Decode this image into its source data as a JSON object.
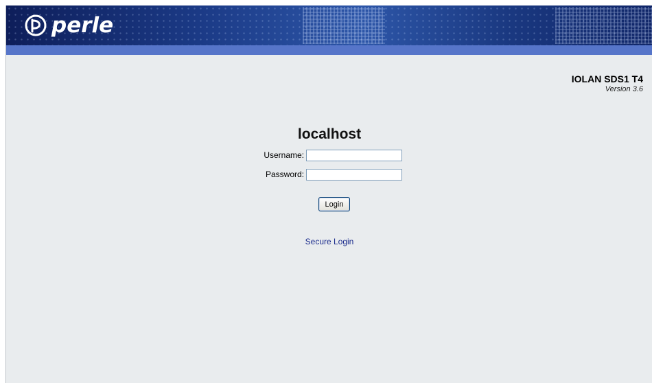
{
  "banner": {
    "logo_text": "perle"
  },
  "product": {
    "name": "IOLAN SDS1 T4",
    "version": "Version 3.6"
  },
  "login": {
    "host": "localhost",
    "username_label": "Username:",
    "password_label": "Password:",
    "username_value": "",
    "password_value": "",
    "login_button": "Login",
    "secure_link": "Secure Login"
  },
  "colors": {
    "banner": "#1b3a86",
    "stripe": "#5675c9",
    "background": "#e9ecee",
    "link": "#1a2b8c"
  }
}
